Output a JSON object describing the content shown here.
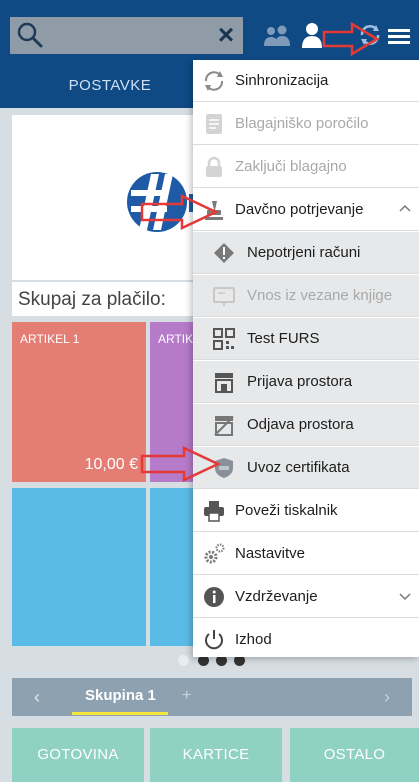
{
  "header": {
    "tab_postavke": "POSTAVKE"
  },
  "main": {
    "total_label": "Skupaj za plačilo:",
    "tiles": [
      {
        "name": "ARTIKEL 1",
        "price": "10,00 €",
        "color": "#e47e75"
      },
      {
        "name": "ARTIK",
        "color": "#b57bc9"
      }
    ],
    "group": {
      "label": "Skupina 1",
      "add": "+"
    },
    "payments": {
      "cash": "GOTOVINA",
      "cards": "KARTICE",
      "other": "OSTALO"
    }
  },
  "menu": {
    "sync": "Sinhronizacija",
    "cash_report": "Blagajniško poročilo",
    "close_register": "Zaključi blagajno",
    "tax_confirm": "Davčno potrjevanje",
    "unconfirmed": "Nepotrjeni računi",
    "import_book": "Vnos iz vezane knjige",
    "test_furs": "Test FURS",
    "register_premises": "Prijava prostora",
    "deregister_premises": "Odjava prostora",
    "import_cert": "Uvoz certifikata",
    "connect_printer": "Poveži tiskalnik",
    "settings": "Nastavitve",
    "maintenance": "Vzdrževanje",
    "exit": "Izhod"
  },
  "colors": {
    "header_blue": "#0f4a85",
    "accent_red": "#e53935",
    "pay_teal": "#8fd1c3",
    "tile_blue": "#5bbbe7"
  }
}
